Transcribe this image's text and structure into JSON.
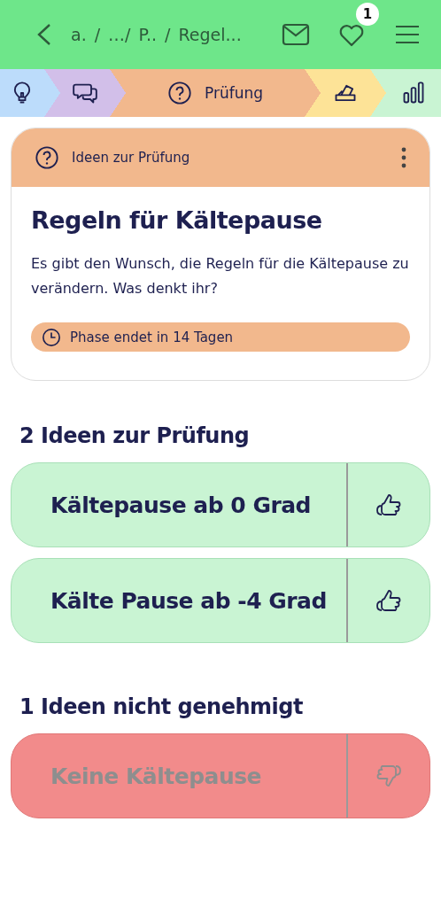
{
  "header": {
    "breadcrumb": [
      "a.",
      "/",
      "…/",
      "P..",
      "/",
      "Regel..."
    ],
    "notification_count": "1"
  },
  "phases": [
    {
      "kind": "idea",
      "color": "#bcdcfb",
      "selected": false
    },
    {
      "kind": "discussion",
      "color": "#d2bfe9",
      "selected": false
    },
    {
      "kind": "review",
      "color": "#f2b88d",
      "selected": true,
      "label": "Prüfung"
    },
    {
      "kind": "vote",
      "color": "#fde397",
      "selected": false
    },
    {
      "kind": "results",
      "color": "#c9f4d3",
      "selected": false
    }
  ],
  "card": {
    "header": "Ideen zur Prüfung",
    "title": "Regeln für Kältepause",
    "description": "Es gibt den Wunsch, die Regeln für die Kältepause zu verändern. Was denkt ihr?",
    "deadline": "Phase endet in 14 Tagen"
  },
  "sections": [
    {
      "title": "2 Ideen zur Prüfung",
      "kind": "pending",
      "ideas": [
        {
          "title": "Kältepause ab 0 Grad"
        },
        {
          "title": "Kälte Pause ab -4 Grad"
        }
      ]
    },
    {
      "title": "1 Ideen nicht genehmigt",
      "kind": "rejected",
      "ideas": [
        {
          "title": "Keine Kältepause"
        }
      ]
    }
  ]
}
